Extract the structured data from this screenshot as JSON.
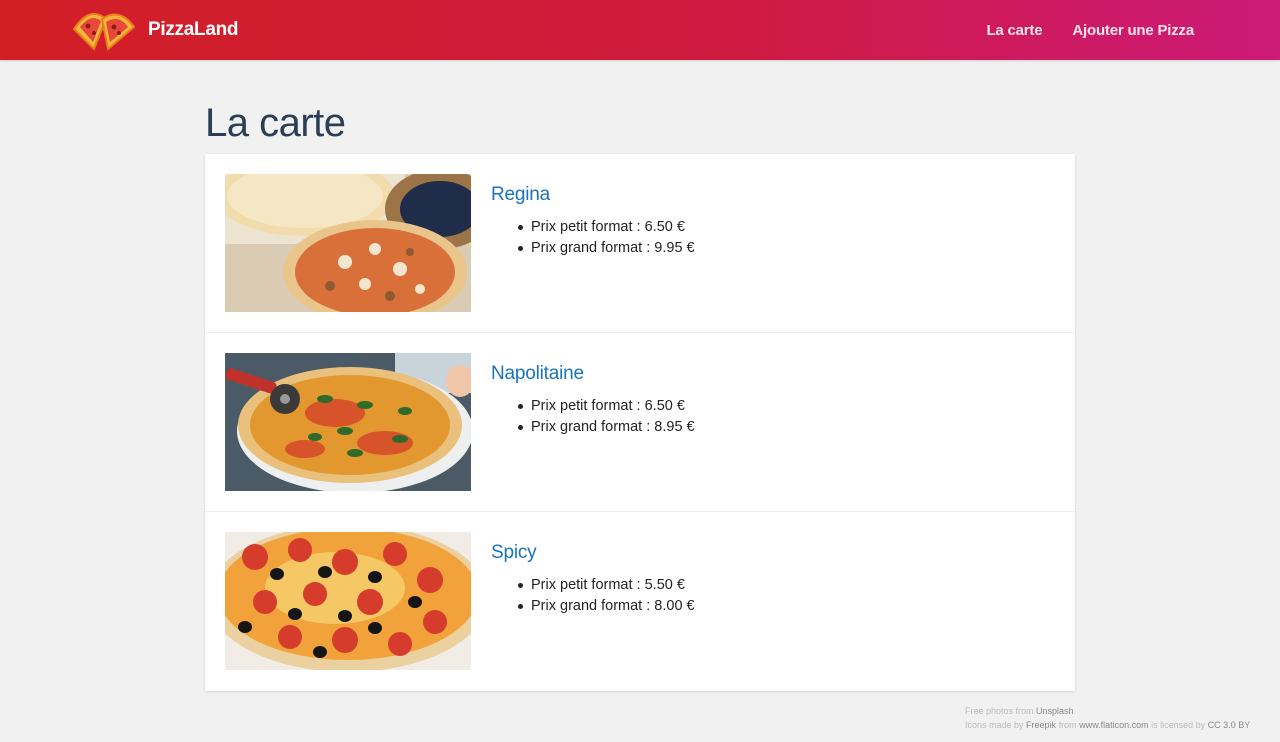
{
  "header": {
    "brand": "PizzaLand",
    "nav": [
      {
        "label": "La carte"
      },
      {
        "label": "Ajouter une Pizza"
      }
    ]
  },
  "page": {
    "title": "La carte"
  },
  "pizzas": [
    {
      "name": "Regina",
      "small": "Prix petit format : 6.50 €",
      "large": "Prix grand format : 9.95 €"
    },
    {
      "name": "Napolitaine",
      "small": "Prix petit format : 6.50 €",
      "large": "Prix grand format : 8.95 €"
    },
    {
      "name": "Spicy",
      "small": "Prix petit format : 5.50 €",
      "large": "Prix grand format : 8.00 €"
    }
  ],
  "footer": {
    "line1_prefix": "Free photos from",
    "line1_link": "Unsplash",
    "line2_prefix": "Icons made by",
    "line2_author": "Freepik",
    "line2_from": "from",
    "line2_site": "www.flaticon.com",
    "line2_licensed": "is licensed by",
    "line2_license": "CC 3.0 BY"
  },
  "colors": {
    "header_start": "#d21f25",
    "header_end": "#cc1a78",
    "link": "#1a74bb",
    "title": "#2b3e55"
  }
}
